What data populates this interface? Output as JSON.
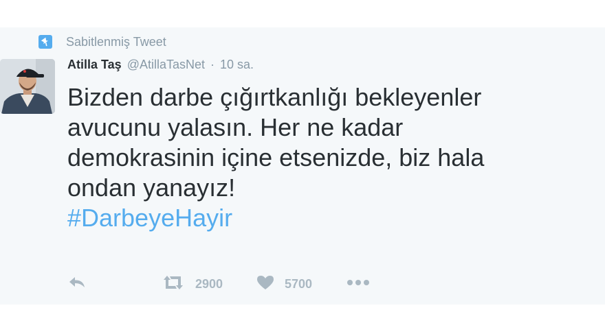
{
  "pinned": {
    "label": "Sabitlenmiş Tweet",
    "icon": "pin-icon"
  },
  "tweet": {
    "author_name": "Atilla Taş",
    "handle": "@AtillaTasNet",
    "separator": "·",
    "time": "10 sa.",
    "lines": [
      "Bizden darbe çığırtkanlığı bekleyenler",
      "avucunu yalasın. Her ne kadar",
      "demokrasinin içine etsenizde, biz hala",
      "ondan yanayız!"
    ],
    "hashtag": "#DarbeyeHayir"
  },
  "actions": {
    "reply_icon": "reply-icon",
    "retweet_icon": "retweet-icon",
    "retweet_count": "2900",
    "like_icon": "heart-icon",
    "like_count": "5700",
    "more_icon": "more-icon"
  },
  "colors": {
    "accent": "#55acee",
    "text": "#292f33",
    "muted": "#8899a6",
    "action": "#aab8c2",
    "card_bg": "#f5f8fa"
  }
}
